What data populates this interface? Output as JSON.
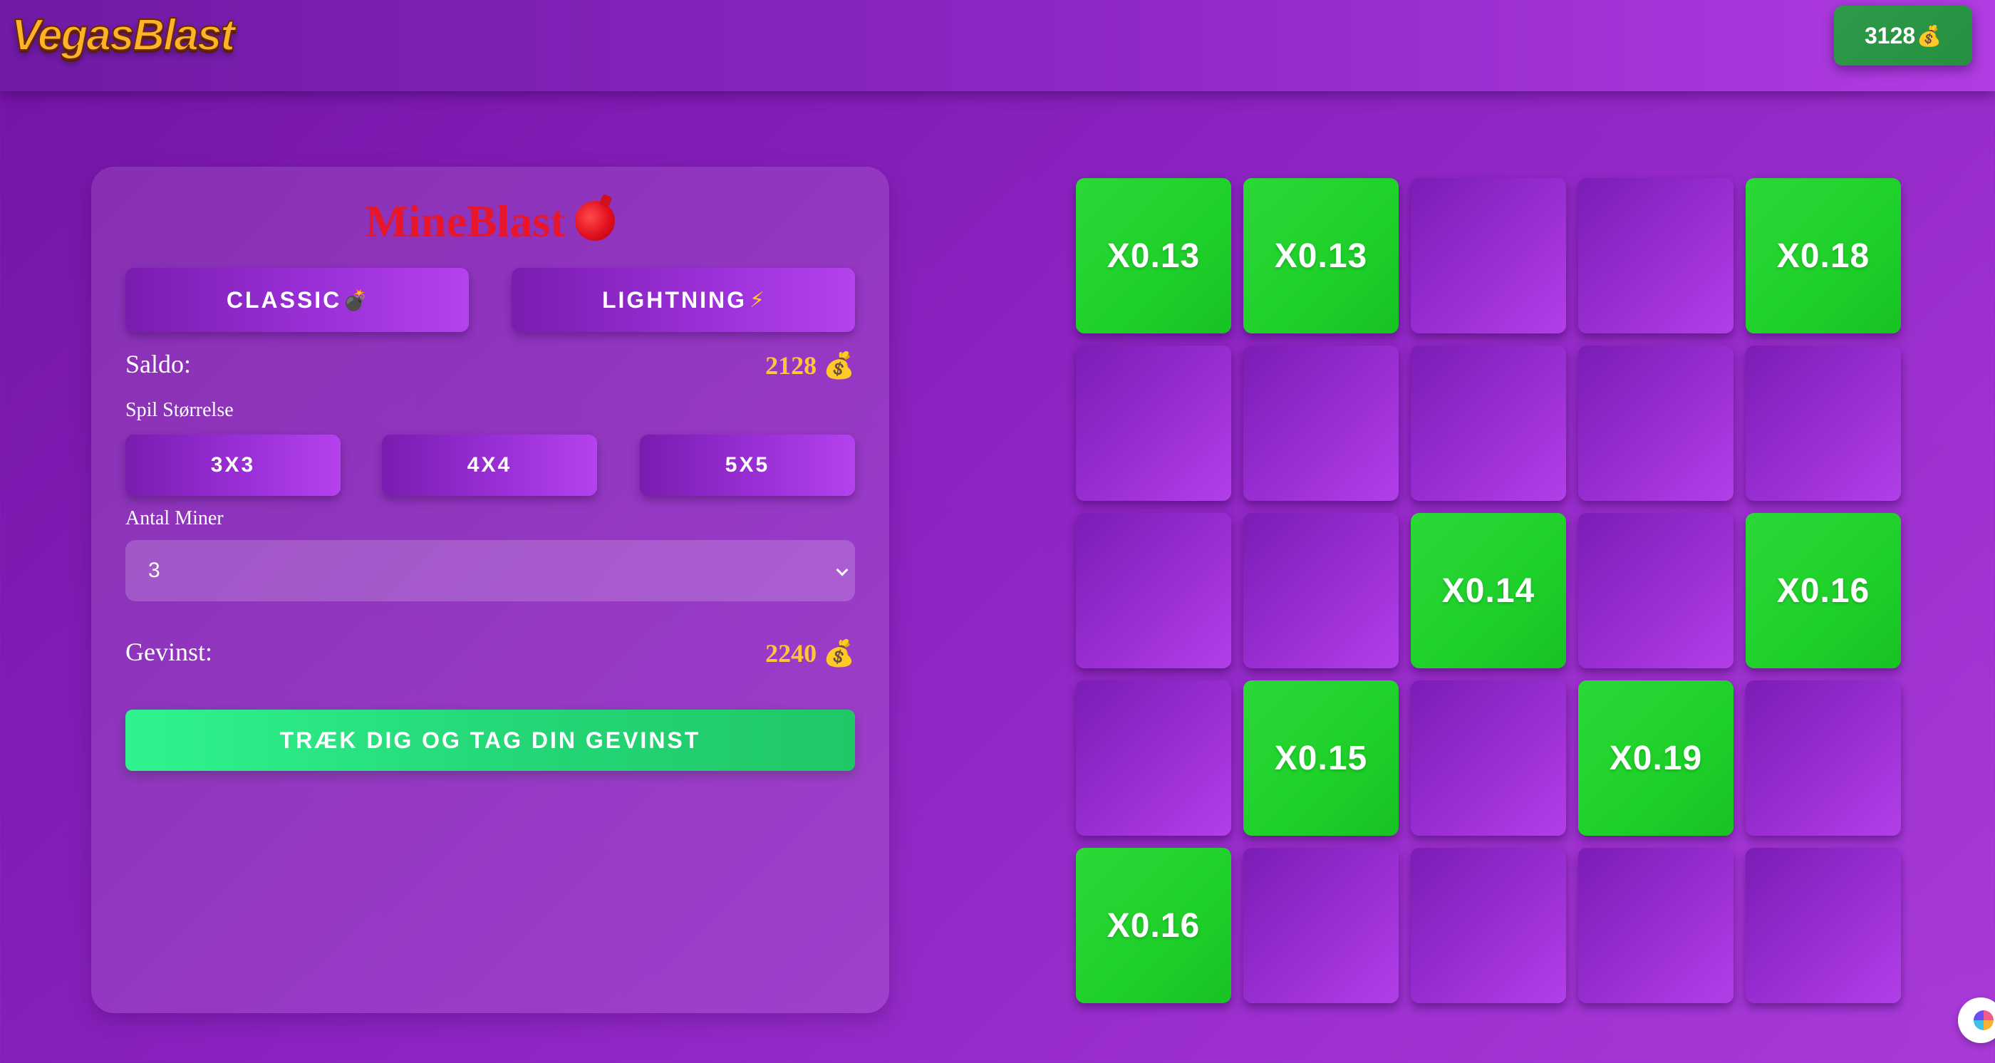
{
  "header": {
    "logo": "VegasBlast",
    "balance": "3128",
    "balance_icon": "💰"
  },
  "panel": {
    "title": "MineBlast",
    "modes": [
      {
        "label": "CLASSIC",
        "icon": "💣",
        "icon_name": "bomb-icon"
      },
      {
        "label": "LIGHTNING",
        "icon": "⚡",
        "icon_name": "lightning-icon"
      }
    ],
    "saldo_label": "Saldo:",
    "saldo_value": "2128",
    "coin_icon": "💰",
    "size_label": "Spil Størrelse",
    "sizes": [
      "3X3",
      "4X4",
      "5X5"
    ],
    "mines_label": "Antal Miner",
    "mines_value": "3",
    "win_label": "Gevinst:",
    "win_value": "2240",
    "cashout_label": "TRÆK DIG OG TAG DIN GEVINST"
  },
  "grid": {
    "rows": [
      [
        "X0.13",
        "X0.13",
        "",
        "",
        "X0.18"
      ],
      [
        "",
        "",
        "",
        "",
        ""
      ],
      [
        "",
        "",
        "X0.14",
        "",
        "X0.16"
      ],
      [
        "",
        "X0.15",
        "",
        "X0.19",
        ""
      ],
      [
        "X0.16",
        "",
        "",
        "",
        ""
      ]
    ]
  },
  "colors": {
    "tile_revealed": "#1ed02a",
    "tile_hidden": "#9a2ed3",
    "accent_gold": "#ffc43a",
    "title_red": "#e8162a"
  }
}
